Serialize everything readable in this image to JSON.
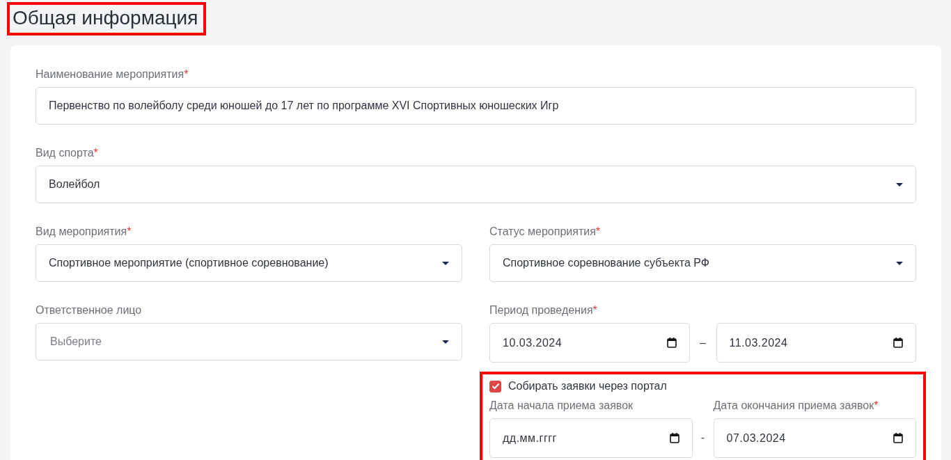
{
  "heading": {
    "text": "Общая информация",
    "highlighted": true
  },
  "event_name": {
    "label": "Наименование мероприятия",
    "required": "*",
    "value": "Первенство по волейболу среди юношей до 17 лет по программе XVI Спортивных юношеских Игр"
  },
  "sport": {
    "label": "Вид спорта",
    "required": "*",
    "value": "Волейбол"
  },
  "event_type": {
    "label": "Вид мероприятия",
    "required": "*",
    "value": "Спортивное мероприятие (спортивное соревнование)"
  },
  "event_status": {
    "label": "Статус мероприятия",
    "required": "*",
    "value": "Спортивное соревнование субъекта РФ"
  },
  "responsible": {
    "label": "Ответственное лицо",
    "placeholder": "Выберите"
  },
  "period": {
    "label": "Период проведения",
    "required": "*",
    "start": {
      "value": "10.03.2024"
    },
    "separator": "–",
    "end": {
      "value": "11.03.2024"
    }
  },
  "portal_section": {
    "highlighted": true,
    "checkbox": {
      "label": "Собирать заявки через портал",
      "checked": true
    },
    "start": {
      "label": "Дата начала приема заявок",
      "placeholder": "дд.мм.гггг"
    },
    "separator": "-",
    "end": {
      "label": "Дата окончания приема заявок",
      "required": "*",
      "value": "07.03.2024"
    }
  }
}
